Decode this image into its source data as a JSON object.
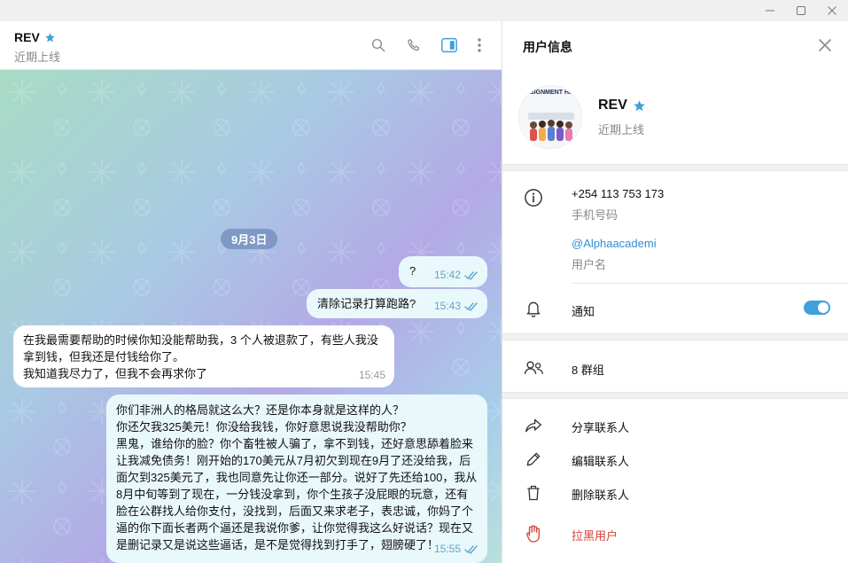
{
  "chat_header": {
    "name": "REV",
    "status": "近期上线"
  },
  "chat": {
    "date_label": "9月3日",
    "messages": [
      {
        "direction": "out",
        "text": "?",
        "time": "15:42",
        "read": true
      },
      {
        "direction": "out",
        "text": "清除记录打算跑路?",
        "time": "15:43",
        "read": true
      },
      {
        "direction": "in",
        "text": "在我最需要帮助的时候你知没能帮助我，3 个人被退款了，有些人我没\n拿到钱，但我还是付钱给你了。\n我知道我尽力了，但我不会再求你了",
        "time": "15:45"
      },
      {
        "direction": "out",
        "text": "你们非洲人的格局就这么大？还是你本身就是这样的人？\n你还欠我325美元！你没给我钱，你好意思说我没帮助你？\n黑鬼，谁给你的脸？你个畜牲被人骗了，拿不到钱，还好意思舔着脸来\n让我减免债务！刚开始的170美元从7月初欠到现在9月了还没给我，后\n面欠到325美元了，我也同意先让你还一部分。说好了先还给100，我从\n8月中旬等到了现在，一分钱没拿到，你个生孩子没屁眼的玩意，还有\n脸在公群找人给你支付，没找到，后面又来求老子，表忠诚，你妈了个\n逼的你下面长者两个逼还是我说你爹，让你觉得我这么好说话？现在又\n是删记录又是说这些逼话，是不是觉得找到打手了，翅膀硬了！",
        "time": "15:55",
        "read": true
      }
    ]
  },
  "info_panel": {
    "title": "用户信息",
    "avatar_text": "ASSIGNMENT HELP",
    "name": "REV",
    "status": "近期上线",
    "phone": "+254 113 753 173",
    "phone_label": "手机号码",
    "username": "@Alphaacademi",
    "username_label": "用户名",
    "notifications_label": "通知",
    "notifications_on": true,
    "groups_label": "8 群组",
    "actions": {
      "share": "分享联系人",
      "edit": "编辑联系人",
      "delete": "删除联系人",
      "block": "拉黑用户"
    }
  },
  "colors": {
    "accent": "#3fa0db",
    "star": "#3fa0db",
    "danger": "#d9433a",
    "outgoing_bubble": "#e9f8fb",
    "incoming_bubble": "#ffffff"
  }
}
